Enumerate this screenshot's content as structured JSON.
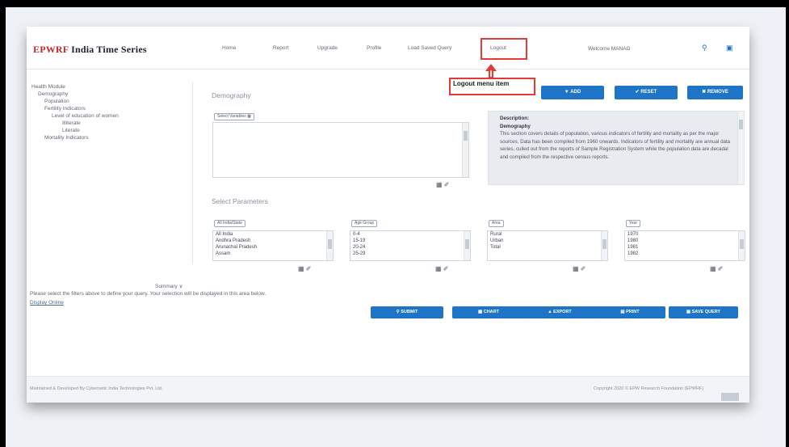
{
  "app": {
    "brand": "EPWRF",
    "title": "India Time Series"
  },
  "nav": {
    "items": [
      "Home",
      "Report",
      "Upgrade",
      "Profile",
      "Load Saved Query",
      "Logout"
    ],
    "welcome": "Welcome MANAG"
  },
  "callout": {
    "text": "Logout menu item"
  },
  "tree": {
    "items": [
      "Health Module",
      "Demography",
      "Population",
      "Fertility Indicators",
      "Level of education of women",
      "Illiterate",
      "Literate",
      "Mortality Indicators"
    ]
  },
  "page": {
    "section_title": "Demography",
    "params_title": "Select Parameters"
  },
  "top_buttons": {
    "add": "ADD",
    "reset": "RESET",
    "remove": "REMOVE"
  },
  "indicator": {
    "pill": "Select Variables"
  },
  "description": {
    "label": "Description:",
    "heading": "Demography",
    "body": "This section covers details of population, various indicators of fertility and mortality as per the major sources. Data has been compiled from 1960 onwards. Indicators of fertility and mortality are annual data series, culled out from the reports of Sample Registration System while the population data are decadal and compiled from the respective census reports."
  },
  "params": [
    {
      "pill": "All India/State",
      "items": [
        "All India",
        "Andhra Pradesh",
        "Arunachal Pradesh",
        "Assam"
      ]
    },
    {
      "pill": "Age Group",
      "items": [
        "0-4",
        "15-19",
        "20-24",
        "25-29"
      ]
    },
    {
      "pill": "Area",
      "items": [
        "Rural",
        "Urban",
        "Total"
      ]
    },
    {
      "pill": "Year",
      "items": [
        "1970",
        "1980",
        "1981",
        "1982"
      ]
    }
  ],
  "summary": {
    "label": "Summary ∨",
    "note": "Please select the filters above to define your query. Your selection will be displayed in this area below.",
    "display_link": "Display Online"
  },
  "actions": {
    "submit": "SUBMIT",
    "chart": "CHART",
    "export": "EXPORT",
    "print": "PRINT",
    "save": "SAVE QUERY"
  },
  "footer": {
    "left": "Maintained & Developed By Cybernetic India Technologies Pvt. Ltd.",
    "right": "Copyright 2020 © EPW Research Foundation (EPWRF)"
  },
  "colors": {
    "accent": "#1e74c6",
    "highlight": "#e53935",
    "brand": "#c62828"
  }
}
